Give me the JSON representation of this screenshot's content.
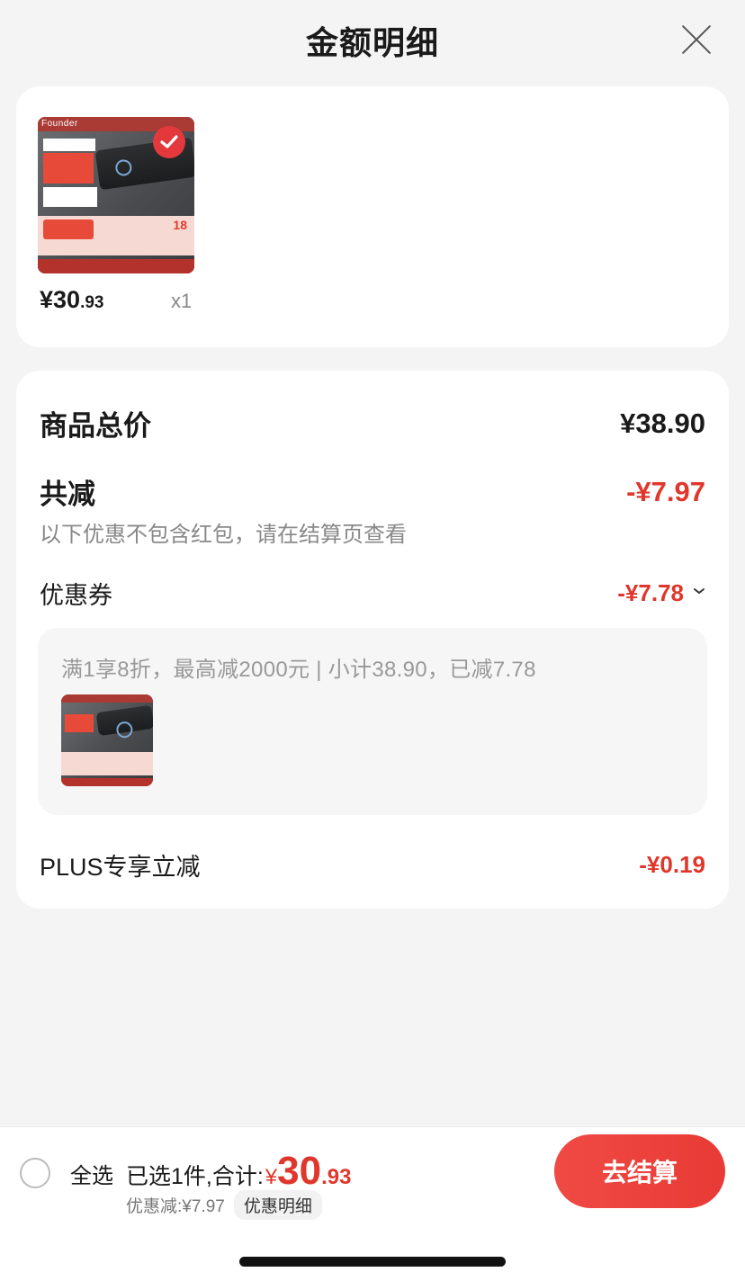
{
  "header": {
    "title": "金额明细"
  },
  "product": {
    "price_int": "¥30",
    "price_dec": ".93",
    "quantity": "x1",
    "selected": true
  },
  "summary": {
    "total_label": "商品总价",
    "total_value": "¥38.90",
    "reduce_label": "共减",
    "reduce_value": "-¥7.97",
    "note": "以下优惠不包含红包，请在结算页查看",
    "coupon_label": "优惠券",
    "coupon_value": "-¥7.78",
    "coupon_detail": "满1享8折，最高减2000元 | 小计38.90，已减7.78",
    "plus_label": "PLUS专享立减",
    "plus_value": "-¥0.19"
  },
  "bottom_bar": {
    "select_all": "全选",
    "selected_text": "已选1件,合计:",
    "total_yen": "¥",
    "total_int": "30",
    "total_dec": ".93",
    "discount_text": "优惠减:¥7.97",
    "detail_label": "优惠明细",
    "checkout_label": "去结算"
  },
  "colors": {
    "accent": "#e0372c",
    "background": "#f4f4f4",
    "card": "#ffffff"
  },
  "icons": {
    "close": "close-icon",
    "check": "check-icon"
  }
}
